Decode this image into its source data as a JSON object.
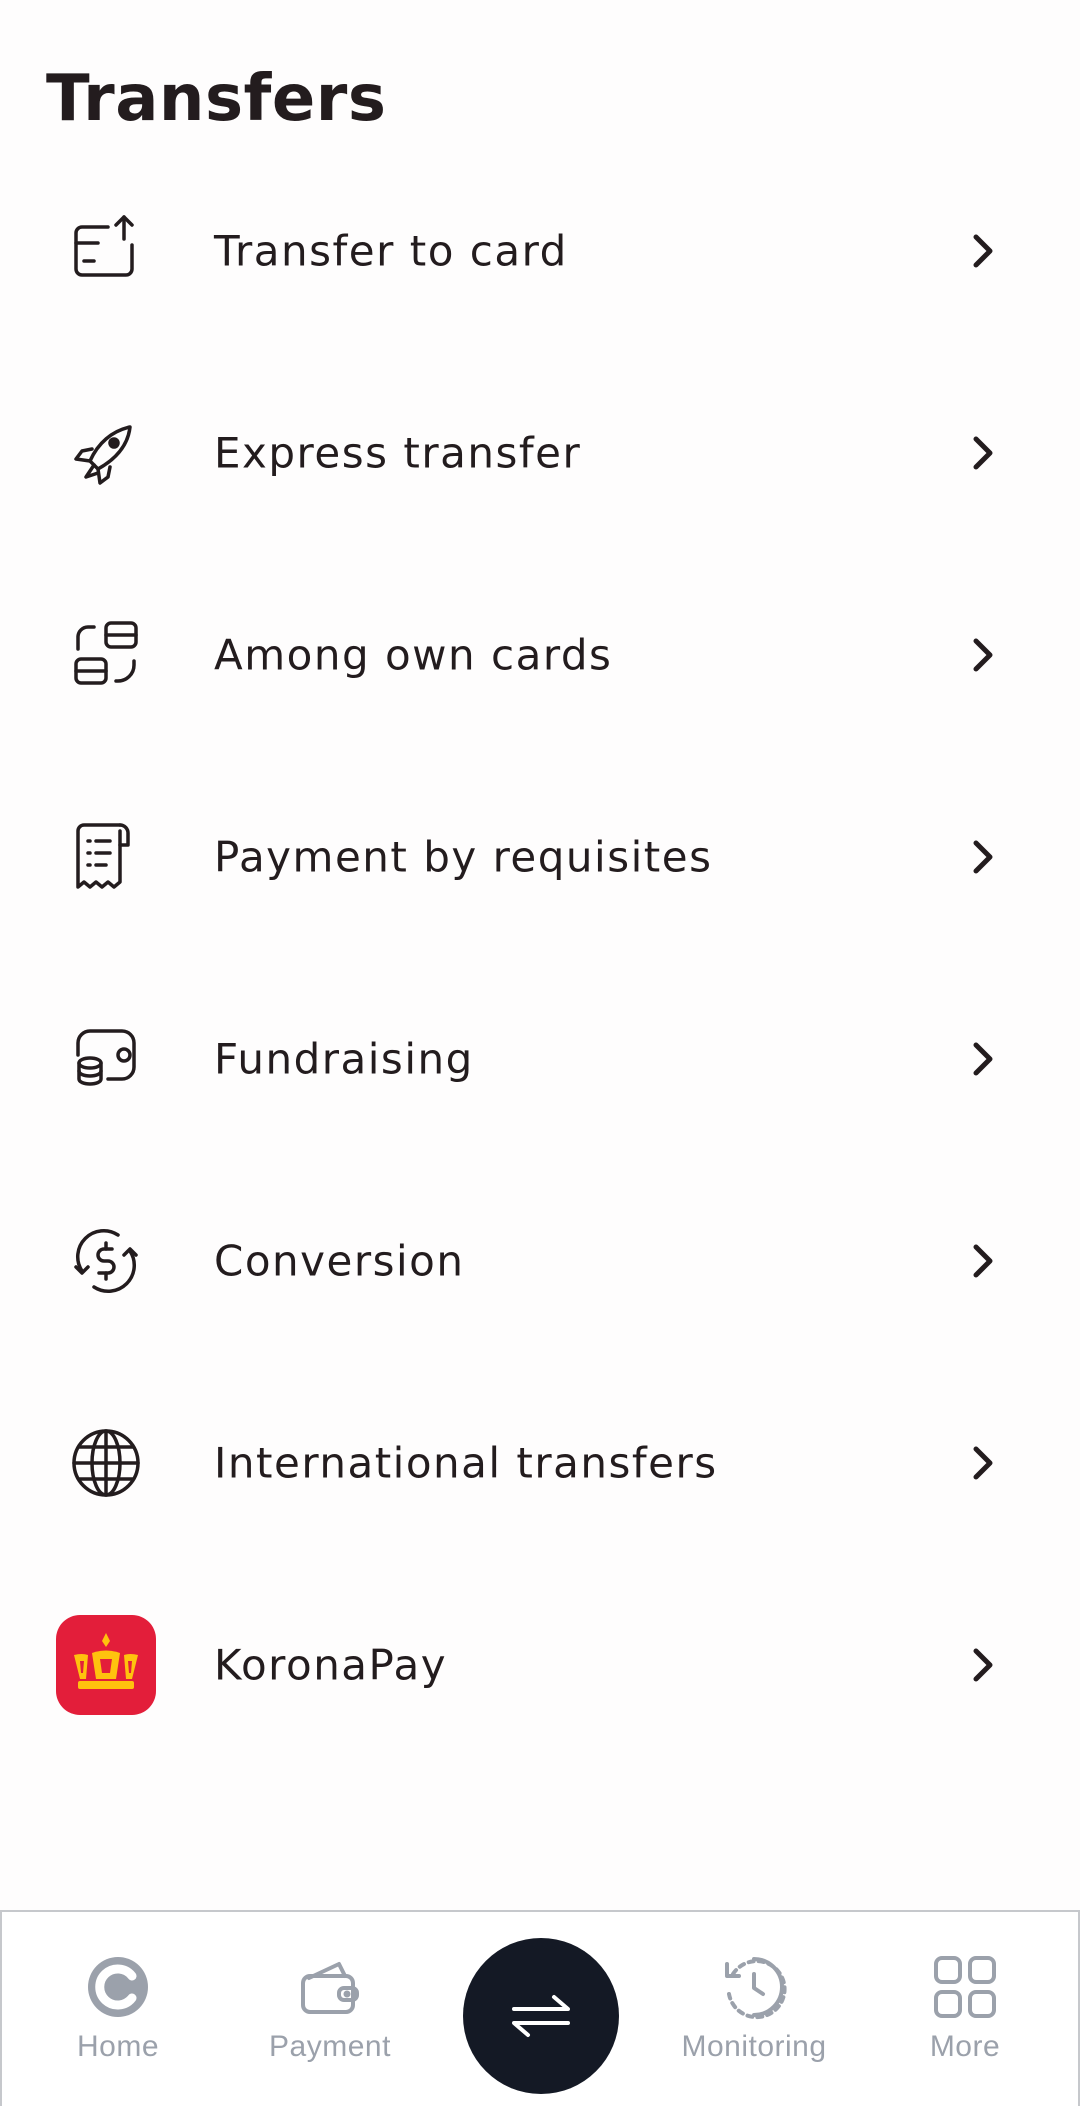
{
  "header": {
    "title": "Transfers"
  },
  "menu": {
    "items": [
      {
        "label": "Transfer to card",
        "icon": "card-upload-icon"
      },
      {
        "label": "Express transfer",
        "icon": "rocket-icon"
      },
      {
        "label": "Among own cards",
        "icon": "card-swap-icon"
      },
      {
        "label": "Payment by requisites",
        "icon": "receipt-icon"
      },
      {
        "label": "Fundraising",
        "icon": "coins-jar-icon"
      },
      {
        "label": "Conversion",
        "icon": "currency-exchange-icon"
      },
      {
        "label": "International transfers",
        "icon": "globe-icon"
      },
      {
        "label": "KoronaPay",
        "icon": "korona-crown-icon"
      }
    ]
  },
  "bottom_nav": {
    "items": [
      {
        "label": "Home",
        "icon": "home-logo-icon"
      },
      {
        "label": "Payment",
        "icon": "wallet-icon"
      },
      {
        "label": "",
        "icon": "transfer-arrows-icon"
      },
      {
        "label": "Monitoring",
        "icon": "history-clock-icon"
      },
      {
        "label": "More",
        "icon": "grid-icon"
      }
    ]
  },
  "colors": {
    "text": "#231c1e",
    "nav_inactive": "#9ba1ab",
    "fab_background": "#141925",
    "korona_red": "#e31e3a",
    "korona_gold": "#ffc20e"
  }
}
